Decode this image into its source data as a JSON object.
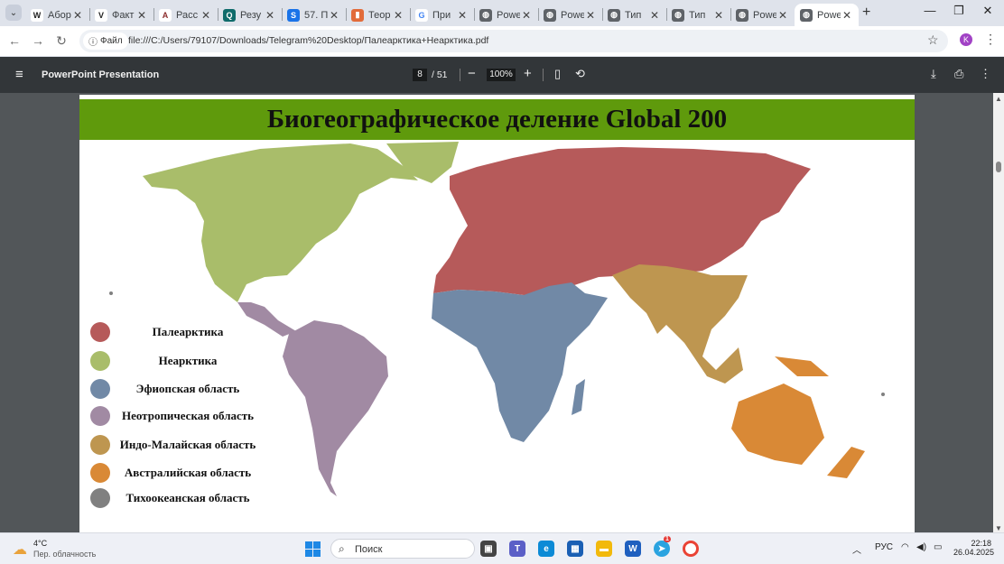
{
  "browser": {
    "tabs": [
      {
        "title": "Абор",
        "favicon": "W",
        "color": "#ffffff",
        "fg": "#222"
      },
      {
        "title": "Факт",
        "favicon": "V",
        "color": "#ffffff",
        "fg": "#222"
      },
      {
        "title": "Расс",
        "favicon": "A",
        "color": "#ffffff",
        "fg": "#8b2d2d"
      },
      {
        "title": "Резу",
        "favicon": "Q",
        "color": "#0f6b6b",
        "fg": "#fff"
      },
      {
        "title": "57. П",
        "favicon": "S",
        "color": "#1a73e8",
        "fg": "#fff"
      },
      {
        "title": "Теор",
        "favicon": "▮",
        "color": "#e26b3a",
        "fg": "#fff"
      },
      {
        "title": "При",
        "favicon": "G",
        "color": "#ffffff",
        "fg": "#4285f4"
      },
      {
        "title": "Powe",
        "favicon": "◍",
        "color": "#5f6368",
        "fg": "#fff"
      },
      {
        "title": "Powe",
        "favicon": "◍",
        "color": "#5f6368",
        "fg": "#fff"
      },
      {
        "title": "Тип",
        "favicon": "◍",
        "color": "#5f6368",
        "fg": "#fff"
      },
      {
        "title": "Тип",
        "favicon": "◍",
        "color": "#5f6368",
        "fg": "#fff"
      },
      {
        "title": "Powe",
        "favicon": "◍",
        "color": "#5f6368",
        "fg": "#fff"
      },
      {
        "title": "Powe",
        "favicon": "◍",
        "color": "#5f6368",
        "fg": "#fff",
        "active": true
      }
    ],
    "site_chip": "Файл",
    "url": "file:///C:/Users/79107/Downloads/Telegram%20Desktop/Палеарктика+Неарктика.pdf",
    "profile_initial": "K"
  },
  "pdf": {
    "title": "PowerPoint Presentation",
    "page": "8",
    "total": "/ 51",
    "zoom": "100%"
  },
  "slide": {
    "heading": "Биогеографическое деление Global 200",
    "legend": [
      {
        "label": "Палеарктика",
        "color": "#b65a5a"
      },
      {
        "label": "Неарктика",
        "color": "#a9bd6a"
      },
      {
        "label": "Эфиопская область",
        "color": "#7189a6"
      },
      {
        "label": "Неотропическая область",
        "color": "#a18aa3"
      },
      {
        "label": "Индо-Малайская область",
        "color": "#be9650"
      },
      {
        "label": "Австралийская область",
        "color": "#d98936"
      },
      {
        "label": "Тихоокеанская область",
        "color": "#808080"
      }
    ]
  },
  "taskbar": {
    "temperature": "4°C",
    "condition": "Пер. облачность",
    "search_placeholder": "Поиск",
    "language": "РУС",
    "time": "22:18",
    "date": "26.04.2025",
    "telegram_badge": "1"
  }
}
